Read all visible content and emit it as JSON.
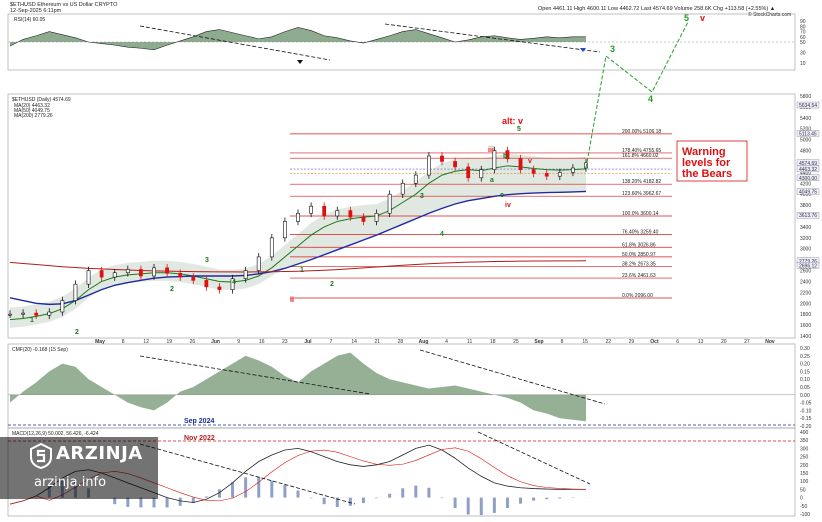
{
  "header": {
    "symbol_line": "$ETHUSD Ethereum vs US Dollar CRYPTO",
    "date": "12-Sep-2025 6:11pm",
    "ohlc": "Open 4461.11  High 4600.11  Low 4462.72  Last 4574.69  Volume 258.6K  Chg +113.58 (+2.55%) ▲",
    "watermark": "© StockCharts.com"
  },
  "rsi_panel": {
    "label": "RSI(14) 60.05",
    "ticks": [
      "90",
      "80",
      "70",
      "60",
      "50",
      "30",
      "10"
    ]
  },
  "price_panel": {
    "label": "$ETHUSD (Daily) 4574.69",
    "legend": [
      {
        "text": "MA(20) 4463.32",
        "color": "#1a7a1a"
      },
      {
        "text": "MA(50) 4049.75",
        "color": "#1f2a9e"
      },
      {
        "text": "MA(200) 2779.26",
        "color": "#b01e1e"
      }
    ],
    "ticks": [
      "5800",
      "5600",
      "5400",
      "5200",
      "5000",
      "4800",
      "4600",
      "4400",
      "4200",
      "4000",
      "3800",
      "3600",
      "3400",
      "3200",
      "3000",
      "2800",
      "2600",
      "2400",
      "2200",
      "2000",
      "1800",
      "1600",
      "1400"
    ],
    "price_flags": [
      "5634.54",
      "5113.45",
      "4574.69",
      "4463.32",
      "4300.00",
      "4049.75",
      "3613.76",
      "2779.26",
      "2696.12"
    ],
    "fib_levels": [
      {
        "label": "200.00% 5106.18",
        "value": 5106
      },
      {
        "label": "178.40% 4755.65",
        "value": 4756
      },
      {
        "label": "161.8% 4660.02",
        "value": 4660
      },
      {
        "label": "138.20% 4182.82",
        "value": 4183
      },
      {
        "label": "123.60% 3962.67",
        "value": 3963
      },
      {
        "label": "100.0% 3600.14",
        "value": 3600
      },
      {
        "label": "76.40% 3259.40",
        "value": 3259
      },
      {
        "label": "61.8% 3026.86",
        "value": 3027
      },
      {
        "label": "50.0% 2850.97",
        "value": 2851
      },
      {
        "label": "38.2% 2673.35",
        "value": 2673
      },
      {
        "label": "23.6% 2461.63",
        "value": 2462
      },
      {
        "label": "0.0% 2096.00",
        "value": 2096
      }
    ],
    "warning": "Warning levels for the Bears",
    "alt_label": "alt: v"
  },
  "dates": [
    "May",
    "8",
    "12",
    "19",
    "26",
    "Jun",
    "9",
    "16",
    "23",
    "Jul",
    "7",
    "14",
    "21",
    "28",
    "Aug",
    "4",
    "11",
    "18",
    "25",
    "Sep",
    "8",
    "15",
    "22",
    "29",
    "Oct",
    "6",
    "13",
    "20",
    "27",
    "Nov"
  ],
  "cmf_panel": {
    "label": "CMF(20) -0.168 (15 Sep)",
    "ticks": [
      "0.30",
      "0.25",
      "0.20",
      "0.15",
      "0.10",
      "0.05",
      "0.00",
      "-0.05",
      "-0.10",
      "-0.15",
      "-0.20"
    ]
  },
  "macd_panel": {
    "label": "MACD(12,26,9) 50.002, 56.426, -6.424",
    "ticks": [
      "400",
      "350",
      "300",
      "250",
      "200",
      "150",
      "100",
      "50",
      "0",
      "-50",
      "-100"
    ]
  },
  "annotations": {
    "sep_2024": "Sep 2024",
    "nov_2022": "Nov 2022"
  },
  "wave_labels": [
    {
      "t": "1",
      "c": "#1a7a1a"
    },
    {
      "t": "2",
      "c": "#1a7a1a"
    },
    {
      "t": "3",
      "c": "#1a7a1a"
    },
    {
      "t": "4",
      "c": "#1a7a1a"
    },
    {
      "t": "5",
      "c": "#1a7a1a"
    },
    {
      "t": "v",
      "c": "#d11"
    },
    {
      "t": "iii",
      "c": "#d11"
    },
    {
      "t": "iv",
      "c": "#d11"
    },
    {
      "t": "ii",
      "c": "#d11"
    },
    {
      "t": "a",
      "c": "#1a7a1a"
    },
    {
      "t": "b",
      "c": "#1a7a1a"
    },
    {
      "t": "c",
      "c": "#1a7a1a"
    }
  ],
  "brand": {
    "name": "ARZINJA",
    "url": "arzinja.info"
  },
  "colors": {
    "fib": "#d31e1e",
    "ma20": "#1a7a1a",
    "ma50": "#1f2a9e",
    "ma200": "#b01e1e",
    "cloud": "#c9d6c9",
    "projection": "#22a022",
    "warning": "#d11",
    "rsi_fill": "#6a8f6a",
    "cmf_neg": "#b87474"
  },
  "chart_data": {
    "type": "line",
    "title": "$ETHUSD (Daily) 4574.69",
    "x_labels": [
      "May",
      "Jun",
      "Jul",
      "Aug",
      "Sep",
      "Oct",
      "Nov"
    ],
    "series": [
      {
        "name": "$ETHUSD",
        "y": [
          1800,
          1820,
          1780,
          1840,
          2050,
          2350,
          2600,
          2480,
          2560,
          2620,
          2500,
          2650,
          2550,
          2480,
          2420,
          2300,
          2250,
          2450,
          2600,
          2850,
          3200,
          3500,
          3650,
          3780,
          3600,
          3700,
          3580,
          3500,
          3650,
          4000,
          4200,
          4350,
          4700,
          4600,
          4500,
          4300,
          4450,
          4800,
          4650,
          4450,
          4380,
          4330,
          4400,
          4480,
          4574
        ]
      },
      {
        "name": "MA(20) 4463.32",
        "y": [
          1700,
          1720,
          1760,
          1810,
          1900,
          2050,
          2250,
          2400,
          2480,
          2520,
          2540,
          2560,
          2560,
          2540,
          2500,
          2450,
          2400,
          2390,
          2420,
          2500,
          2650,
          2850,
          3050,
          3250,
          3400,
          3500,
          3550,
          3580,
          3600,
          3700,
          3850,
          4000,
          4200,
          4350,
          4420,
          4450,
          4430,
          4480,
          4520,
          4500,
          4470,
          4450,
          4440,
          4450,
          4463
        ]
      },
      {
        "name": "MA(50) 4049.75",
        "y": [
          2100,
          2050,
          2000,
          1980,
          1990,
          2050,
          2150,
          2250,
          2330,
          2380,
          2420,
          2460,
          2480,
          2490,
          2500,
          2500,
          2500,
          2500,
          2510,
          2540,
          2580,
          2640,
          2720,
          2800,
          2890,
          2980,
          3070,
          3160,
          3250,
          3350,
          3450,
          3550,
          3650,
          3740,
          3820,
          3880,
          3920,
          3960,
          3990,
          4010,
          4020,
          4030,
          4035,
          4042,
          4050
        ]
      },
      {
        "name": "MA(200) 2779.26",
        "y": [
          2750,
          2730,
          2710,
          2690,
          2670,
          2655,
          2640,
          2630,
          2620,
          2610,
          2600,
          2595,
          2590,
          2585,
          2580,
          2578,
          2576,
          2575,
          2574,
          2575,
          2578,
          2582,
          2588,
          2596,
          2606,
          2618,
          2632,
          2648,
          2664,
          2680,
          2696,
          2710,
          2724,
          2736,
          2746,
          2754,
          2760,
          2765,
          2769,
          2772,
          2774,
          2776,
          2777,
          2778,
          2779
        ]
      }
    ],
    "ylim": [
      1400,
      5800
    ]
  }
}
